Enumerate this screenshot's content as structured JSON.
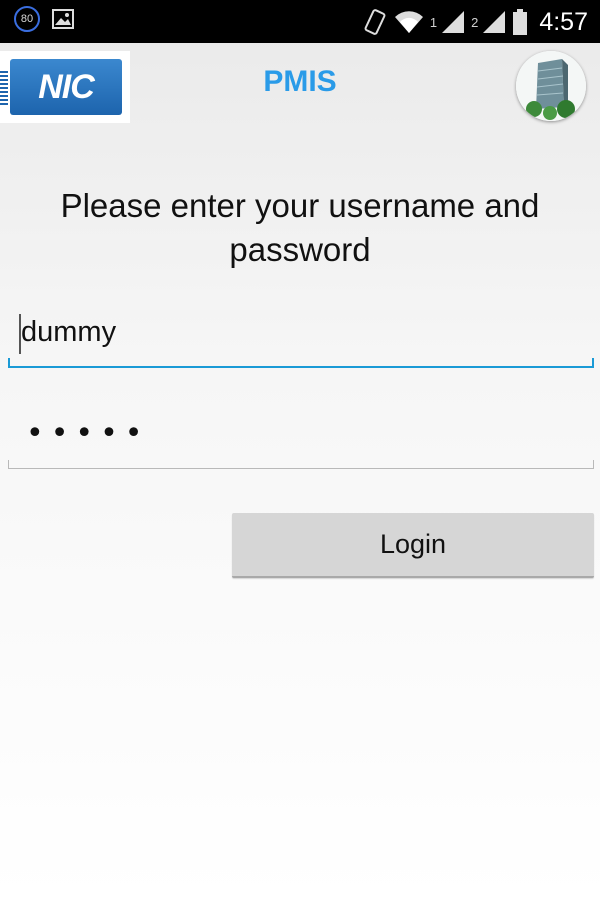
{
  "status_bar": {
    "notification_badge": "80",
    "sim1": "1",
    "sim2": "2",
    "time": "4:57",
    "icons": [
      "gallery-icon",
      "rotate-icon",
      "wifi-icon",
      "signal-icon",
      "battery-icon"
    ]
  },
  "action_bar": {
    "logo_text": "NIC",
    "title": "PMIS",
    "title_color": "#2a9be8"
  },
  "login": {
    "prompt": "Please enter your username and password",
    "username_value": "dummy",
    "password_mask": "•••••",
    "login_button": "Login"
  },
  "colors": {
    "accent": "#1a9ad6",
    "button_bg": "#d6d6d6"
  }
}
